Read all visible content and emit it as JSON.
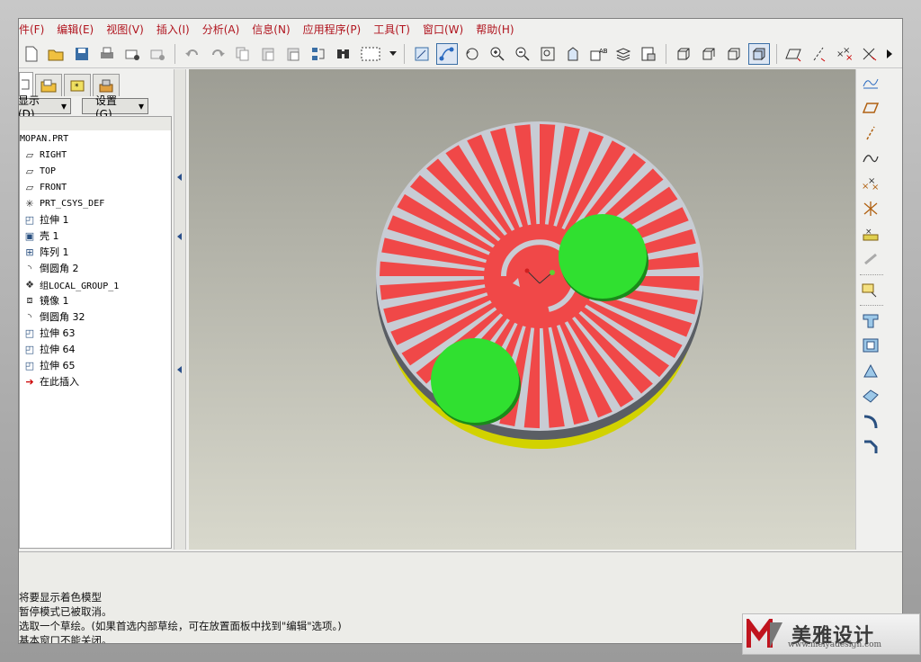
{
  "menu": {
    "items": [
      "件(F)",
      "编辑(E)",
      "视图(V)",
      "插入(I)",
      "分析(A)",
      "信息(N)",
      "应用程序(P)",
      "工具(T)",
      "窗口(W)",
      "帮助(H)"
    ]
  },
  "toolbar": {
    "icons": [
      "new-file-icon",
      "open-folder-icon",
      "save-icon",
      "print-icon",
      "send-mail-icon",
      "send-mail-gray-icon",
      "undo-icon",
      "redo-icon",
      "copy-icon",
      "paste-icon",
      "paste-special-icon",
      "regenerate-icon",
      "find-icon",
      "select-box-icon",
      "sketch-plane-icon",
      "sketch-tool-icon",
      "repaint-icon",
      "zoom-in-icon",
      "zoom-out-icon",
      "fit-window-icon",
      "orient-icon",
      "saved-views-icon",
      "layers-icon",
      "view-manager-icon",
      "wireframe-icon",
      "hidden-line-icon",
      "no-hidden-icon",
      "shaded-icon",
      "plane-display-icon",
      "axis-display-icon",
      "point-display-icon",
      "csys-display-icon"
    ]
  },
  "panel": {
    "show_label": "显示 (D)",
    "settings_label": "设置 (G)"
  },
  "tree": {
    "items": [
      {
        "label": "MOPAN.PRT",
        "icon": "part-icon"
      },
      {
        "label": "RIGHT",
        "icon": "datum-plane-icon"
      },
      {
        "label": "TOP",
        "icon": "datum-plane-icon"
      },
      {
        "label": "FRONT",
        "icon": "datum-plane-icon"
      },
      {
        "label": "PRT_CSYS_DEF",
        "icon": "csys-icon"
      },
      {
        "label": "拉伸 1",
        "icon": "extrude-icon"
      },
      {
        "label": "壳 1",
        "icon": "shell-icon"
      },
      {
        "label": "阵列 1",
        "icon": "pattern-icon"
      },
      {
        "label": "倒圆角 2",
        "icon": "round-icon"
      },
      {
        "label": "组LOCAL_GROUP_1",
        "icon": "group-icon"
      },
      {
        "label": "镜像 1",
        "icon": "mirror-icon"
      },
      {
        "label": "倒圆角 32",
        "icon": "round-icon"
      },
      {
        "label": "拉伸 63",
        "icon": "extrude-icon"
      },
      {
        "label": "拉伸 64",
        "icon": "extrude-icon"
      },
      {
        "label": "拉伸 65",
        "icon": "extrude-icon"
      },
      {
        "label": "在此插入",
        "icon": "insert-here-arrow-icon"
      }
    ]
  },
  "messages": [
    "将要显示着色模型",
    "暂停模式已被取消。",
    "选取一个草绘。(如果首选内部草绘，可在放置面板中找到\"编辑\"选项。)",
    "基本窗口不能关闭。"
  ],
  "watermark": {
    "text": "美雅设计",
    "url": "www.meiyadesign.com"
  },
  "colors": {
    "menu_text": "#b0141e",
    "disk_red": "#f04848",
    "rib_gray": "#c8ccd4",
    "knob_green": "#30e030",
    "rim_yellow": "#d2d200"
  }
}
